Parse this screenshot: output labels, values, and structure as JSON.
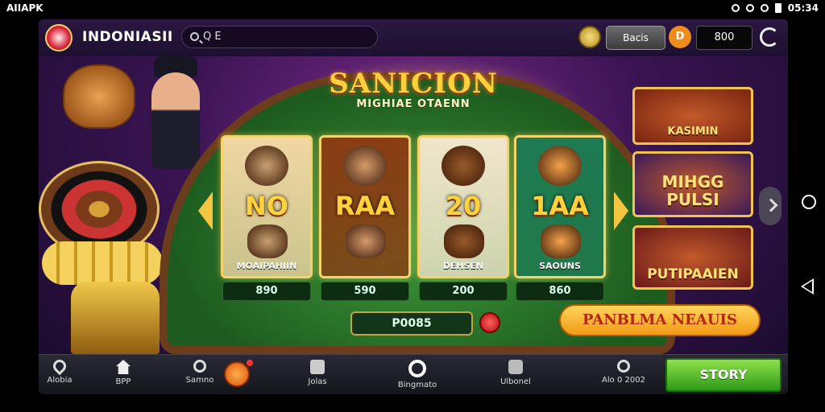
{
  "statusbar": {
    "left": "AIIAPK",
    "time": "05:34"
  },
  "header": {
    "app_name": "INDONIASII",
    "search_text": "Q E",
    "balance_label": "Bacis",
    "badge_letter": "D",
    "amount": "800"
  },
  "game": {
    "title": "SANICION",
    "subtitle": "MIGHIAE OTAENN"
  },
  "cards": [
    {
      "big": "NO",
      "caption": "MOAIPAHIIN",
      "value": "890",
      "bg": "#f1d7a4",
      "art": "#c9a070"
    },
    {
      "big": "RAA",
      "caption": "",
      "value": "590",
      "bg": "#8a3d14",
      "art": "#d69a6a"
    },
    {
      "big": "20",
      "caption": "DEHSEN",
      "value": "200",
      "bg": "#f2e6cc",
      "art": "#9a5a2a"
    },
    {
      "big": "1AA",
      "caption": "SAOUNS",
      "value": "860",
      "bg": "#1e7a52",
      "art": "#f4a24a"
    }
  ],
  "pot_value": "P0085",
  "action_banner": "PANBLMA NEAUIS",
  "promos": [
    {
      "label": "KASIMIN",
      "bg": "#7a2410"
    },
    {
      "label": "MIHGG PULSI",
      "bg": "#3a1a5a"
    },
    {
      "label": "PUTIPAAIEN",
      "bg": "#6a1a1a"
    }
  ],
  "bottom_nav": [
    {
      "label": "Alobia",
      "icon": "location-pin-icon"
    },
    {
      "label": "BPP",
      "icon": "home-icon"
    },
    {
      "label": "Samno",
      "icon": "search-icon"
    },
    {
      "label": "Jolas",
      "icon": "bag-icon"
    },
    {
      "label": "Bingmato",
      "icon": "ring-icon"
    },
    {
      "label": "Ulbonel",
      "icon": "wallet-icon"
    },
    {
      "label": "Alo 0 2002",
      "icon": "magnifier-icon"
    }
  ],
  "cta_button": "STORY",
  "colors": {
    "accent": "#ffd13a",
    "table": "#2e7a2e",
    "cta": "#4bbd2a"
  }
}
